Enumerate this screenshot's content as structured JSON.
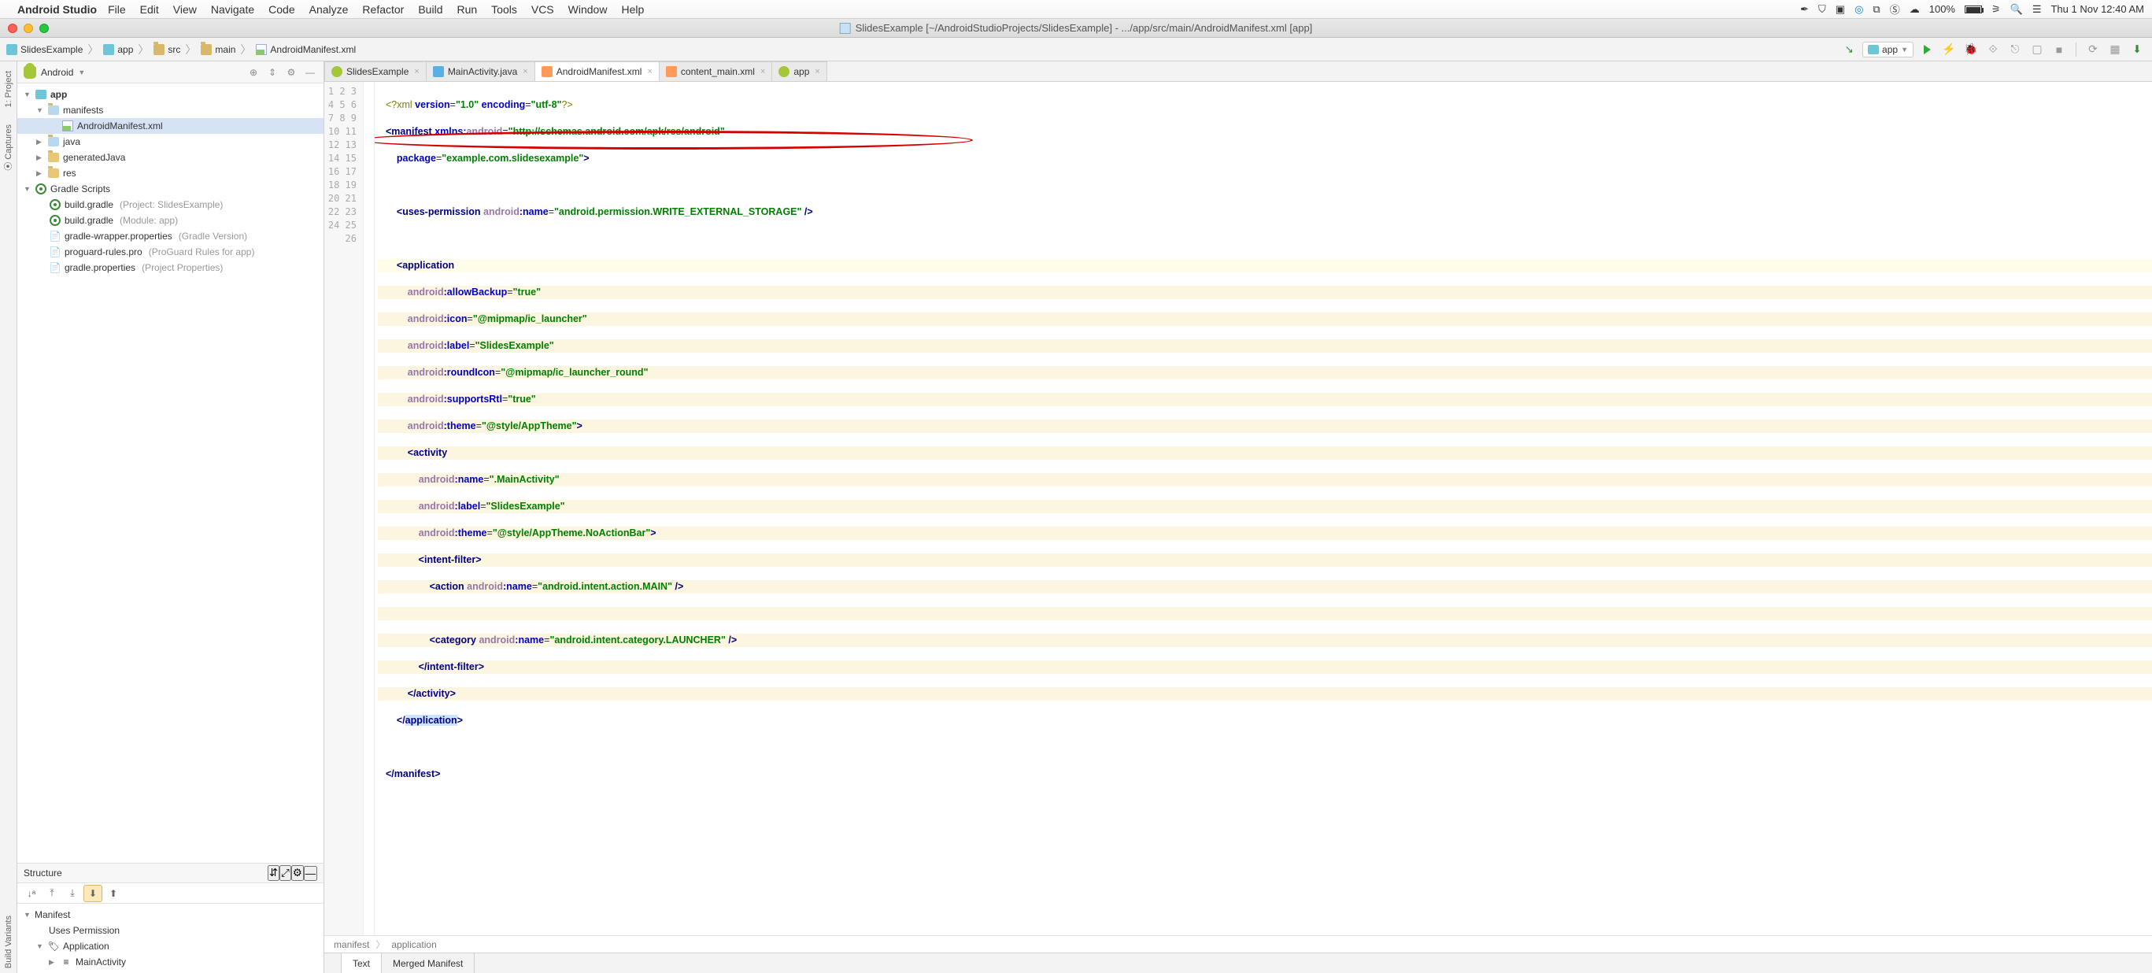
{
  "mac_menu": {
    "app": "Android Studio",
    "items": [
      "File",
      "Edit",
      "View",
      "Navigate",
      "Code",
      "Analyze",
      "Refactor",
      "Build",
      "Run",
      "Tools",
      "VCS",
      "Window",
      "Help"
    ],
    "battery": "100%",
    "clock": "Thu 1 Nov  12:40 AM"
  },
  "window_title": "SlidesExample [~/AndroidStudioProjects/SlidesExample] - .../app/src/main/AndroidManifest.xml [app]",
  "breadcrumbs": [
    "SlidesExample",
    "app",
    "src",
    "main",
    "AndroidManifest.xml"
  ],
  "run_config": "app",
  "project": {
    "view": "Android",
    "tree": {
      "app": "app",
      "manifests": "manifests",
      "manifest_file": "AndroidManifest.xml",
      "java": "java",
      "generatedJava": "generatedJava",
      "res": "res",
      "gradle_scripts": "Gradle Scripts",
      "build_gradle_proj": "build.gradle",
      "build_gradle_proj_hint": "(Project: SlidesExample)",
      "build_gradle_mod": "build.gradle",
      "build_gradle_mod_hint": "(Module: app)",
      "wrapper": "gradle-wrapper.properties",
      "wrapper_hint": "(Gradle Version)",
      "proguard": "proguard-rules.pro",
      "proguard_hint": "(ProGuard Rules for app)",
      "gradle_props": "gradle.properties",
      "gradle_props_hint": "(Project Properties)"
    }
  },
  "structure": {
    "title": "Structure",
    "items": {
      "manifest": "Manifest",
      "uses_permission": "Uses Permission",
      "application": "Application",
      "main_activity": "MainActivity"
    }
  },
  "editor_tabs": [
    {
      "label": "SlidesExample",
      "type": "and"
    },
    {
      "label": "MainActivity.java",
      "type": "java"
    },
    {
      "label": "AndroidManifest.xml",
      "type": "xmlf",
      "active": true
    },
    {
      "label": "content_main.xml",
      "type": "xmlf"
    },
    {
      "label": "app",
      "type": "app"
    }
  ],
  "editor_crumbs": [
    "manifest",
    "application"
  ],
  "bottom_tabs": {
    "text": "Text",
    "merged": "Merged Manifest"
  },
  "line_count": 26,
  "code": {
    "l1a": "<?xml ",
    "l1b": "version",
    "l1c": "=",
    "l1d": "\"1.0\"",
    "l1e": " encoding",
    "l1f": "=",
    "l1g": "\"utf-8\"",
    "l1h": "?>",
    "l2a": "<manifest ",
    "l2b": "xmlns:",
    "l2c": "android",
    "l2d": "=",
    "l2e": "\"http://schemas.android.com/apk/res/android\"",
    "l3a": "    ",
    "l3b": "package",
    "l3c": "=",
    "l3d": "\"example.com.slidesexample\"",
    "l3e": ">",
    "l5a": "    <uses-permission ",
    "l5b": "android",
    "l5c": ":name",
    "l5d": "=",
    "l5e": "\"android.permission.WRITE_EXTERNAL_STORAGE\"",
    "l5f": " />",
    "l7a": "    <application",
    "l8a": "        ",
    "l8b": "android",
    "l8c": ":allowBackup",
    "l8d": "=",
    "l8e": "\"true\"",
    "l9a": "        ",
    "l9b": "android",
    "l9c": ":icon",
    "l9d": "=",
    "l9e": "\"@mipmap/ic_launcher\"",
    "l10a": "        ",
    "l10b": "android",
    "l10c": ":label",
    "l10d": "=",
    "l10e": "\"SlidesExample\"",
    "l11a": "        ",
    "l11b": "android",
    "l11c": ":roundIcon",
    "l11d": "=",
    "l11e": "\"@mipmap/ic_launcher_round\"",
    "l12a": "        ",
    "l12b": "android",
    "l12c": ":supportsRtl",
    "l12d": "=",
    "l12e": "\"true\"",
    "l13a": "        ",
    "l13b": "android",
    "l13c": ":theme",
    "l13d": "=",
    "l13e": "\"@style/AppTheme\"",
    "l13f": ">",
    "l14a": "        <activity",
    "l15a": "            ",
    "l15b": "android",
    "l15c": ":name",
    "l15d": "=",
    "l15e": "\".MainActivity\"",
    "l16a": "            ",
    "l16b": "android",
    "l16c": ":label",
    "l16d": "=",
    "l16e": "\"SlidesExample\"",
    "l17a": "            ",
    "l17b": "android",
    "l17c": ":theme",
    "l17d": "=",
    "l17e": "\"@style/AppTheme.NoActionBar\"",
    "l17f": ">",
    "l18a": "            <intent-filter>",
    "l19a": "                <action ",
    "l19b": "android",
    "l19c": ":name",
    "l19d": "=",
    "l19e": "\"android.intent.action.MAIN\"",
    "l19f": " />",
    "l21a": "                <category ",
    "l21b": "android",
    "l21c": ":name",
    "l21d": "=",
    "l21e": "\"android.intent.category.LAUNCHER\"",
    "l21f": " />",
    "l22a": "            </intent-filter>",
    "l23a": "        </activity>",
    "l24a": "    </",
    "l24b": "application",
    "l24c": ">",
    "l26a": "</manifest>"
  }
}
